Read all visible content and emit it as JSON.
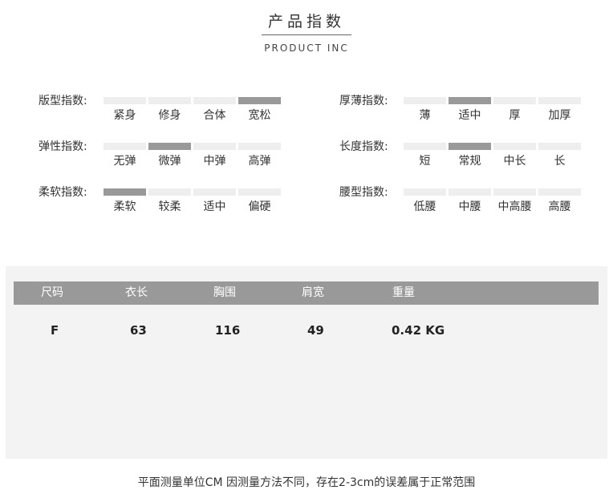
{
  "header": {
    "title": "产品指数",
    "subtitle": "PRODUCT INC"
  },
  "indices": {
    "fit": {
      "label": "版型指数:",
      "options": [
        "紧身",
        "修身",
        "合体",
        "宽松"
      ],
      "selected": 3
    },
    "thickness": {
      "label": "厚薄指数:",
      "options": [
        "薄",
        "适中",
        "厚",
        "加厚"
      ],
      "selected": 1
    },
    "elasticity": {
      "label": "弹性指数:",
      "options": [
        "无弹",
        "微弹",
        "中弹",
        "高弹"
      ],
      "selected": 1
    },
    "length": {
      "label": "长度指数:",
      "options": [
        "短",
        "常规",
        "中长",
        "长"
      ],
      "selected": 1
    },
    "softness": {
      "label": "柔软指数:",
      "options": [
        "柔软",
        "较柔",
        "适中",
        "偏硬"
      ],
      "selected": 0
    },
    "waist": {
      "label": "腰型指数:",
      "options": [
        "低腰",
        "中腰",
        "中高腰",
        "高腰"
      ],
      "selected": -1
    }
  },
  "size_table": {
    "headers": [
      "尺码",
      "衣长",
      "胸围",
      "肩宽",
      "重量"
    ],
    "rows": [
      [
        "F",
        "63",
        "116",
        "49",
        "0.42 KG"
      ]
    ]
  },
  "note": "平面测量单位CM 因测量方法不同，存在2-3cm的误差属于正常范围",
  "colors": {
    "selected_bar": "#999999",
    "unselected_bar": "#eeeeee",
    "table_header": "#999999",
    "panel_bg": "#f3f3f3"
  }
}
